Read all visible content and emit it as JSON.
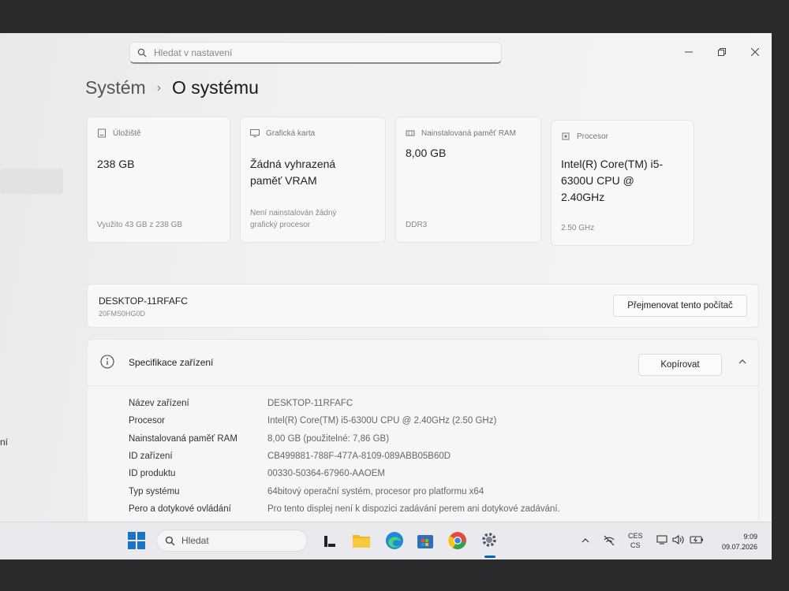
{
  "search": {
    "placeholder": "Hledat v nastavení"
  },
  "breadcrumb": {
    "parent": "Systém",
    "current": "O systému"
  },
  "sidebar": {
    "partial_label": "ní"
  },
  "cards": [
    {
      "title": "Úložiště",
      "icon": "storage-icon",
      "value": "238 GB",
      "sub": "Využito 43 GB z 238 GB"
    },
    {
      "title": "Grafická karta",
      "icon": "display-icon",
      "value": "Žádná vyhrazená paměť VRAM",
      "sub": "Není nainstalován žádný grafický procesor"
    },
    {
      "title": "Nainstalovaná paměť RAM",
      "icon": "memory-icon",
      "value": "8,00 GB",
      "sub": "DDR3"
    },
    {
      "title": "Procesor",
      "icon": "cpu-icon",
      "value": "Intel(R) Core(TM) i5-6300U CPU @ 2.40GHz",
      "sub": "2.50 GHz"
    }
  ],
  "device": {
    "name": "DESKTOP-11RFAFC",
    "model": "20FMS0HG0D",
    "rename_label": "Přejmenovat tento počítač"
  },
  "spec": {
    "title": "Specifikace zařízení",
    "copy_label": "Kopírovat",
    "rows": [
      {
        "label": "Název zařízení",
        "value": "DESKTOP-11RFAFC"
      },
      {
        "label": "Procesor",
        "value": "Intel(R) Core(TM) i5-6300U CPU @ 2.40GHz (2.50 GHz)"
      },
      {
        "label": "Nainstalovaná paměť RAM",
        "value": "8,00 GB (použitelné: 7,86 GB)"
      },
      {
        "label": "ID zařízení",
        "value": "CB499881-788F-477A-8109-089ABB05B60D"
      },
      {
        "label": "ID produktu",
        "value": "00330-50364-67960-AAOEM"
      },
      {
        "label": "Typ systému",
        "value": "64bitový operační systém, procesor pro platformu x64"
      },
      {
        "label": "Pero a dotykové ovládání",
        "value": "Pro tento displej není k dispozici zadávání perem ani dotykové zadávání."
      }
    ]
  },
  "taskbar": {
    "search_label": "Hledat",
    "lang_top": "CES",
    "lang_bottom": "CS",
    "time": "9:09",
    "date": "09.07.2026"
  },
  "colors": {
    "accent": "#0067c0",
    "window_bg": "#f3f3f3"
  }
}
